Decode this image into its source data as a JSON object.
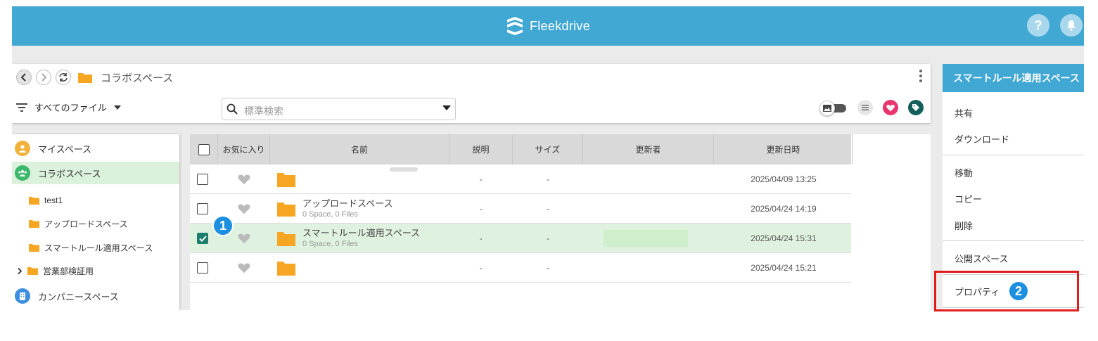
{
  "header": {
    "brand": "Fleekdrive",
    "help_symbol": "?"
  },
  "breadcrumb": {
    "current": "コラボスペース"
  },
  "filter": {
    "label": "すべてのファイル"
  },
  "search": {
    "placeholder": "標準検索"
  },
  "colors": {
    "brand": "#41a8d4",
    "selected_row": "#dff2df",
    "badge": "#1d8fe0",
    "highlight": "#e11c1c",
    "folder": "#f6a623"
  },
  "sidebar": {
    "items": [
      {
        "label": "マイスペース",
        "icon": "user-icon"
      },
      {
        "label": "コラボスペース",
        "icon": "group-icon",
        "selected": true
      },
      {
        "label": "test1",
        "icon": "folder-icon"
      },
      {
        "label": "アップロードスペース",
        "icon": "folder-icon"
      },
      {
        "label": "スマートルール適用スペース",
        "icon": "folder-icon"
      },
      {
        "label": "営業部検証用",
        "icon": "folder-icon"
      },
      {
        "label": "カンパニースペース",
        "icon": "building-icon"
      }
    ]
  },
  "table": {
    "columns": {
      "favorite": "お気に入り",
      "name": "名前",
      "description": "説明",
      "size": "サイズ",
      "updater": "更新者",
      "updated": "更新日時"
    },
    "rows": [
      {
        "name": "",
        "meta": "",
        "description": "-",
        "size": "-",
        "updated": "2025/04/09 13:25",
        "checked": false
      },
      {
        "name": "アップロードスペース",
        "meta": "0 Space, 0 Files",
        "description": "-",
        "size": "-",
        "updated": "2025/04/24 14:19",
        "checked": false
      },
      {
        "name": "スマートルール適用スペース",
        "meta": "0 Space, 0 Files",
        "description": "-",
        "size": "-",
        "updated": "2025/04/24 15:31",
        "checked": true
      },
      {
        "name": "",
        "meta": "",
        "description": "-",
        "size": "-",
        "updated": "2025/04/24 15:21",
        "checked": false
      }
    ]
  },
  "right_panel": {
    "title": "スマートルール適用スペース",
    "items": [
      "共有",
      "ダウンロード",
      "移動",
      "コピー",
      "削除",
      "公開スペース",
      "プロパティ"
    ]
  },
  "steps": {
    "one": "1",
    "two": "2"
  }
}
